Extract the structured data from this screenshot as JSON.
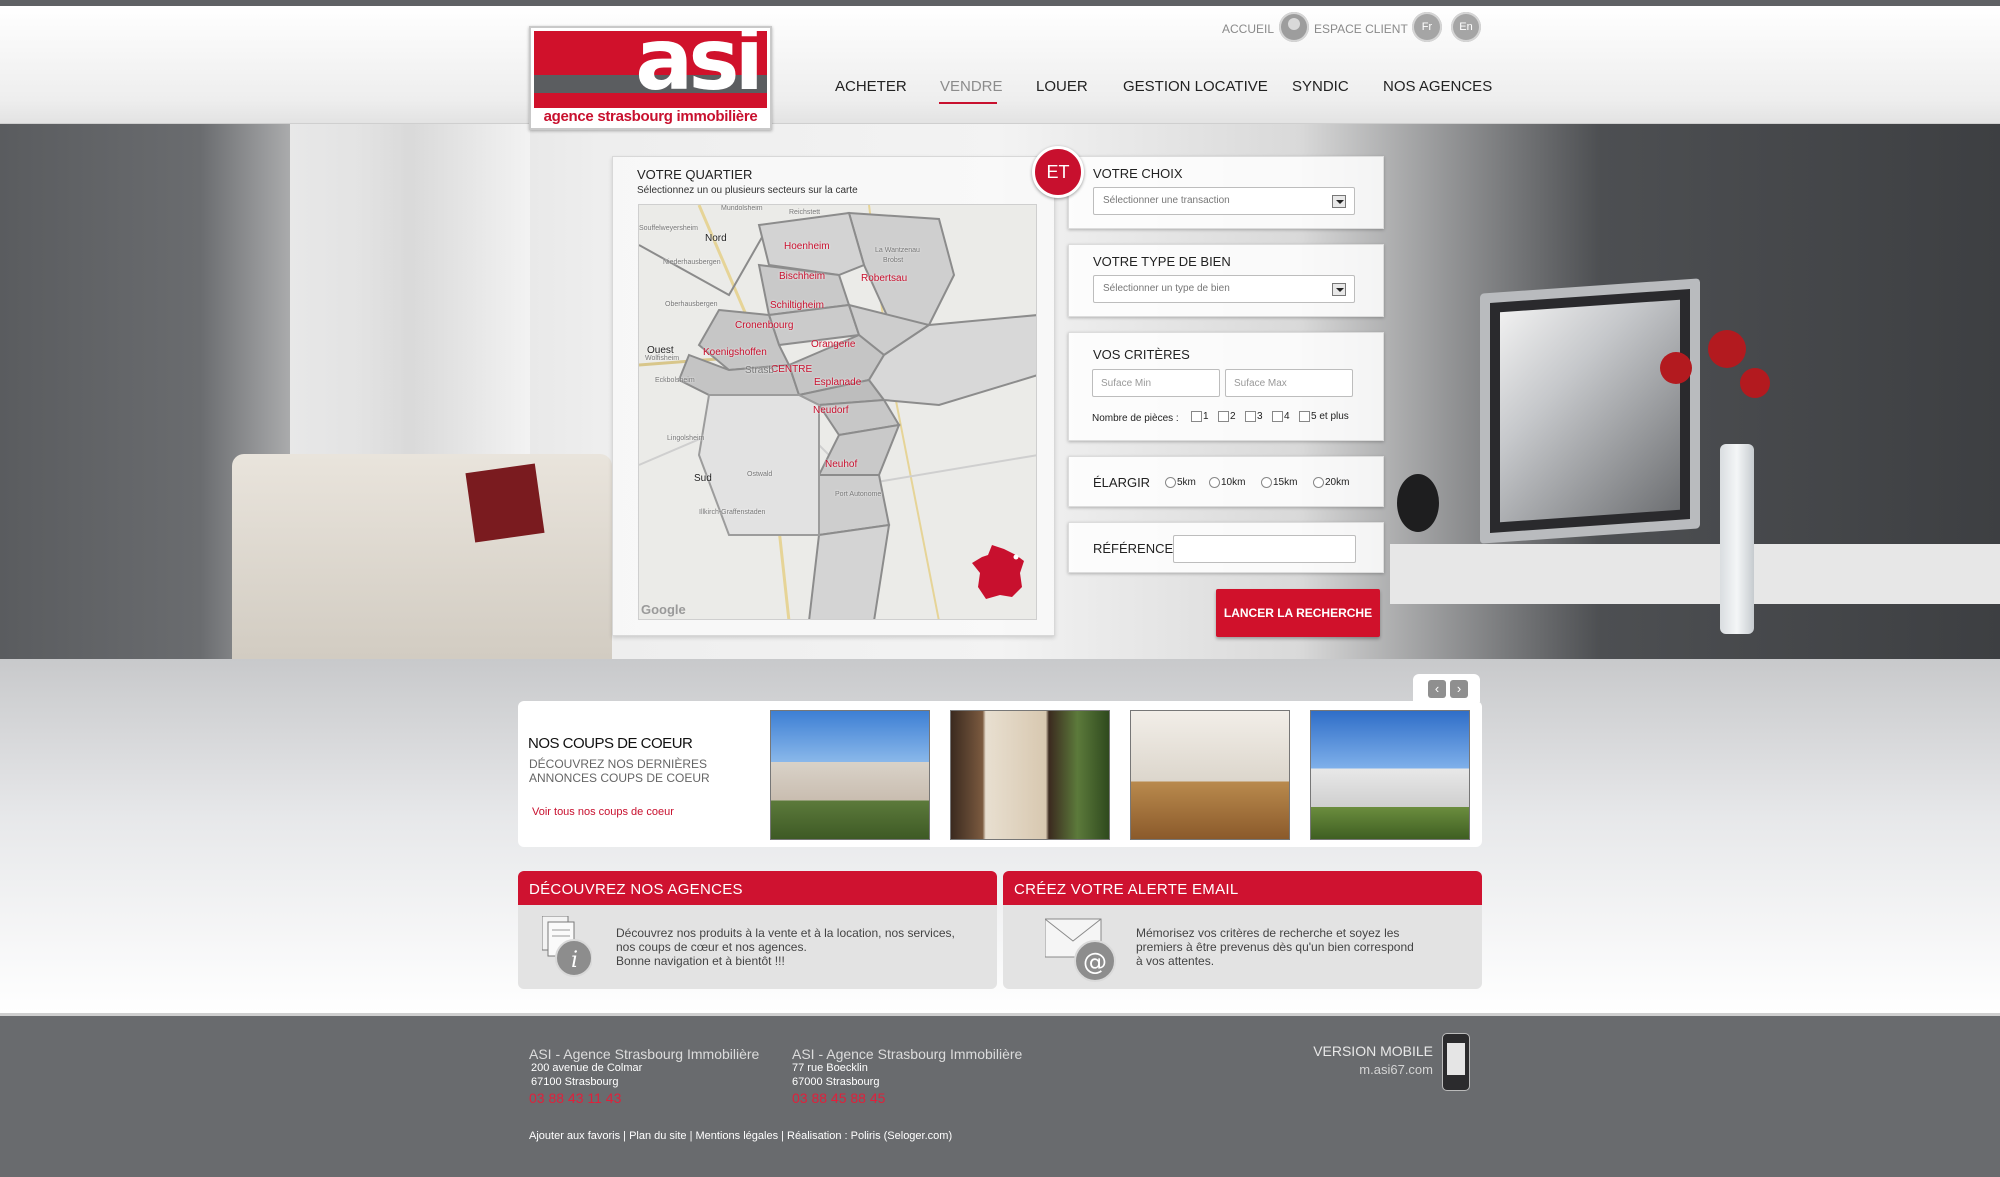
{
  "header": {
    "logo_text": "asi",
    "logo_tagline": "agence strasbourg immobilière",
    "util": {
      "home": "ACCUEIL",
      "client": "ESPACE CLIENT",
      "lang_fr": "Fr",
      "lang_en": "En"
    },
    "nav": [
      "ACHETER",
      "VENDRE",
      "LOUER",
      "GESTION LOCATIVE",
      "SYNDIC",
      "NOS AGENCES"
    ],
    "active_nav": "VENDRE",
    "accent_color": "#c8102e"
  },
  "map_panel": {
    "title": "VOTRE QUARTIER",
    "subtitle": "Sélectionnez un ou plusieurs secteurs sur la carte",
    "districts": [
      "Hoenheim",
      "Bischheim",
      "Robertsau",
      "Schiltigheim",
      "Cronenbourg",
      "Orangerie",
      "Koenigshoffen",
      "CENTRE",
      "Esplanade",
      "Neudorf",
      "Neuhof"
    ],
    "zones": [
      "Nord",
      "Ouest",
      "Sud"
    ],
    "map_places": [
      "Mundolsheim",
      "Reichstett",
      "Souffelweyersheim",
      "Niederhausbergen",
      "Oberhausbergen",
      "Wolfisheim",
      "Eckbolsheim",
      "Lingolsheim",
      "Ostwald",
      "Illkirch-Graffenstaden",
      "Strasb",
      "Port Autonome",
      "La Wantzenau",
      "Brobst"
    ],
    "map_credit": "Google"
  },
  "search_form": {
    "badge": "ET",
    "choix_label": "VOTRE CHOIX",
    "choix_placeholder": "Sélectionner une transaction",
    "type_label": "VOTRE TYPE DE BIEN",
    "type_placeholder": "Sélectionner un type de bien",
    "criteres_label": "VOS CRITÈRES",
    "surface_min": "Suface Min",
    "surface_max": "Suface Max",
    "pieces_label": "Nombre de pièces :",
    "pieces": [
      "1",
      "2",
      "3",
      "4",
      "5 et plus"
    ],
    "elargir_label": "ÉLARGIR",
    "radius": [
      "5km",
      "10km",
      "15km",
      "20km"
    ],
    "reference_label": "RÉFÉRENCE",
    "reference_value": "",
    "search_button": "LANCER LA RECHERCHE"
  },
  "coups_de_coeur": {
    "title": "NOS COUPS DE COEUR",
    "subtitle": "DÉCOUVREZ NOS DERNIÈRES ANNONCES COUPS DE COEUR",
    "link": "Voir tous nos coups de coeur",
    "prev_icon": "chevron-left-icon",
    "next_icon": "chevron-right-icon",
    "photos": [
      "apartment-building-photo",
      "half-timbered-house-photo",
      "living-room-photo",
      "residence-photo"
    ]
  },
  "cards": {
    "agences": {
      "title": "DÉCOUVREZ NOS AGENCES",
      "text_1": "Découvrez nos produits à la vente et à la location, nos services,",
      "text_2": "nos coups de cœur et nos agences.",
      "text_3": "Bonne navigation et à bientôt !!!",
      "icon": "info-document-icon"
    },
    "alerte": {
      "title": "CRÉEZ VOTRE ALERTE EMAIL",
      "text_1": "Mémorisez vos critères de recherche et  soyez les",
      "text_2": "premiers à être prevenus dès qu'un bien correspond",
      "text_3": "à vos attentes.",
      "icon": "email-at-icon"
    }
  },
  "footer": {
    "agency1": {
      "name": "ASI - Agence Strasbourg Immobilière",
      "street": "200 avenue de Colmar",
      "city": "67100 Strasbourg",
      "phone": "03 88 43 11 43"
    },
    "agency2": {
      "name": "ASI - Agence Strasbourg Immobilière",
      "street": "77 rue Boecklin",
      "city": "67000 Strasbourg",
      "phone": "03 88 45 88 45"
    },
    "links": "Ajouter aux favoris | Plan du site | Mentions légales | Réalisation : Poliris (Seloger.com)",
    "mobile_title": "VERSION MOBILE",
    "mobile_url": "m.asi67.com"
  }
}
